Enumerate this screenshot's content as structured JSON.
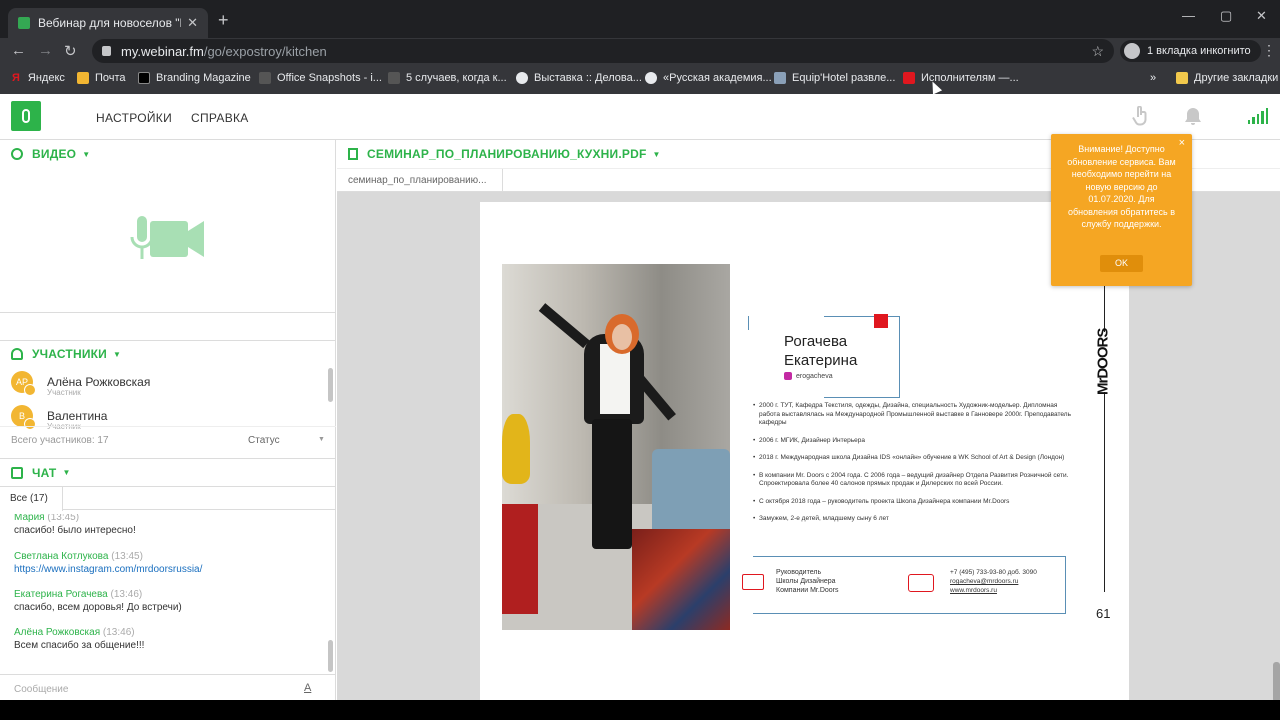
{
  "browser": {
    "tab_title": "Вебинар для новоселов \"Как сп",
    "tab_close": "✕",
    "new_tab": "+",
    "url_host": "my.webinar.fm",
    "url_path": "/go/expostroy/kitchen",
    "incognito_label": "1 вкладка инкогнито",
    "bookmarks": [
      {
        "label": "Яндекс",
        "icon": "yandex-icon",
        "color": "#e0171f"
      },
      {
        "label": "Почта",
        "icon": "mail-icon",
        "color": "#f2b632"
      },
      {
        "label": "Branding Magazine",
        "icon": "bm-icon",
        "color": "#000000"
      },
      {
        "label": "Office Snapshots - i...",
        "icon": "os-icon",
        "color": "#555555"
      },
      {
        "label": "5 случаев, когда к...",
        "icon": "arrow-icon",
        "color": "#555555"
      },
      {
        "label": "Выставка :: Делова...",
        "icon": "globe-icon",
        "color": "#e8eaed"
      },
      {
        "label": "«Русская академия...",
        "icon": "globe-icon",
        "color": "#e8eaed"
      },
      {
        "label": "Equip'Hotel развле...",
        "icon": "page-icon",
        "color": "#8aa0b8"
      },
      {
        "label": "Исполнителям —...",
        "icon": "t-icon",
        "color": "#e0171f"
      }
    ],
    "bookmarks_more": "»",
    "other_bookmarks": "Другие закладки"
  },
  "app": {
    "nav": {
      "settings": "НАСТРОЙКИ",
      "help": "СПРАВКА"
    },
    "video": {
      "title": "ВИДЕО"
    },
    "participants": {
      "title": "УЧАСТНИКИ",
      "items": [
        {
          "initials": "АР",
          "name": "Алёна Рожковская",
          "role": "Участник"
        },
        {
          "initials": "В",
          "name": "Валентина",
          "role": "Участник"
        }
      ],
      "total": "Всего участников: 17",
      "status": "Статус"
    },
    "chat": {
      "title": "ЧАТ",
      "tab_all": "Все (17)",
      "messages": [
        {
          "author": "Мария",
          "time": "(13:45)",
          "text": "спасибо! было интересно!"
        },
        {
          "author": "Светлана Котлукова",
          "time": "(13:45)",
          "text": "https://www.instagram.com/mrdoorsrussia/"
        },
        {
          "author": "Екатерина Рогачева",
          "time": "(13:46)",
          "text": "спасибо, всем доровья! До встречи)"
        },
        {
          "author": "Алёна Рожковская",
          "time": "(13:46)",
          "text": "Всем спасибо за общение!!!"
        }
      ],
      "input_placeholder": "Сообщение",
      "format_label": "A"
    },
    "document": {
      "title": "СЕМИНАР_ПО_ПЛАНИРОВАНИЮ_КУХНИ.PDF",
      "tab": "семинар_по_планированию...",
      "page": {
        "name_line1": "Рогачева",
        "name_line2": "Екатерина",
        "instagram": "erogacheva",
        "bio": [
          "2000 г. ТУТ, Кафедра Текстиля, одежды, Дизайна, специальность Художник-модельер. Дипломная работа выставлялась на Международной Промышленной выставке в Ганновере 2000г. Преподаватель кафедры",
          "2006 г. МГИК, Дизайнер Интерьера",
          "2018 г. Международная школа Дизайна IDS «онлайн» обучение в WK School of Art & Design (Лондон)",
          "В компании Mr. Doors с 2004 года. С 2006 года – ведущий дизайнер Отдела Развития Розничной сети. Спроектировала более 40 салонов прямых продаж и Дилерских по всей России.",
          "С октября 2018 года – руководитель проекта Школа Дизайнера компании Mr.Doors",
          "Замужем, 2-е детей, младшему сыну 6 лет"
        ],
        "role_line1": "Руководитель",
        "role_line2": "Школы Дизайнера",
        "role_line3": "Компании Mr.Doors",
        "phone": "+7 (495) 733-93-80 доб. 3090",
        "email": "rogacheva@mrdoors.ru",
        "site": "www.mrdoors.ru",
        "brand": "MrDOORS",
        "page_number": "61"
      }
    },
    "notice": {
      "text": "Внимание! Доступно обновление сервиса. Вам необходимо перейти на новую версию до 01.07.2020. Для обновления обратитесь в службу поддержки.",
      "ok": "OK",
      "close": "×"
    }
  },
  "colors": {
    "accent": "#2db34a",
    "notice": "#f5a623",
    "link": "#1a6fbf"
  }
}
